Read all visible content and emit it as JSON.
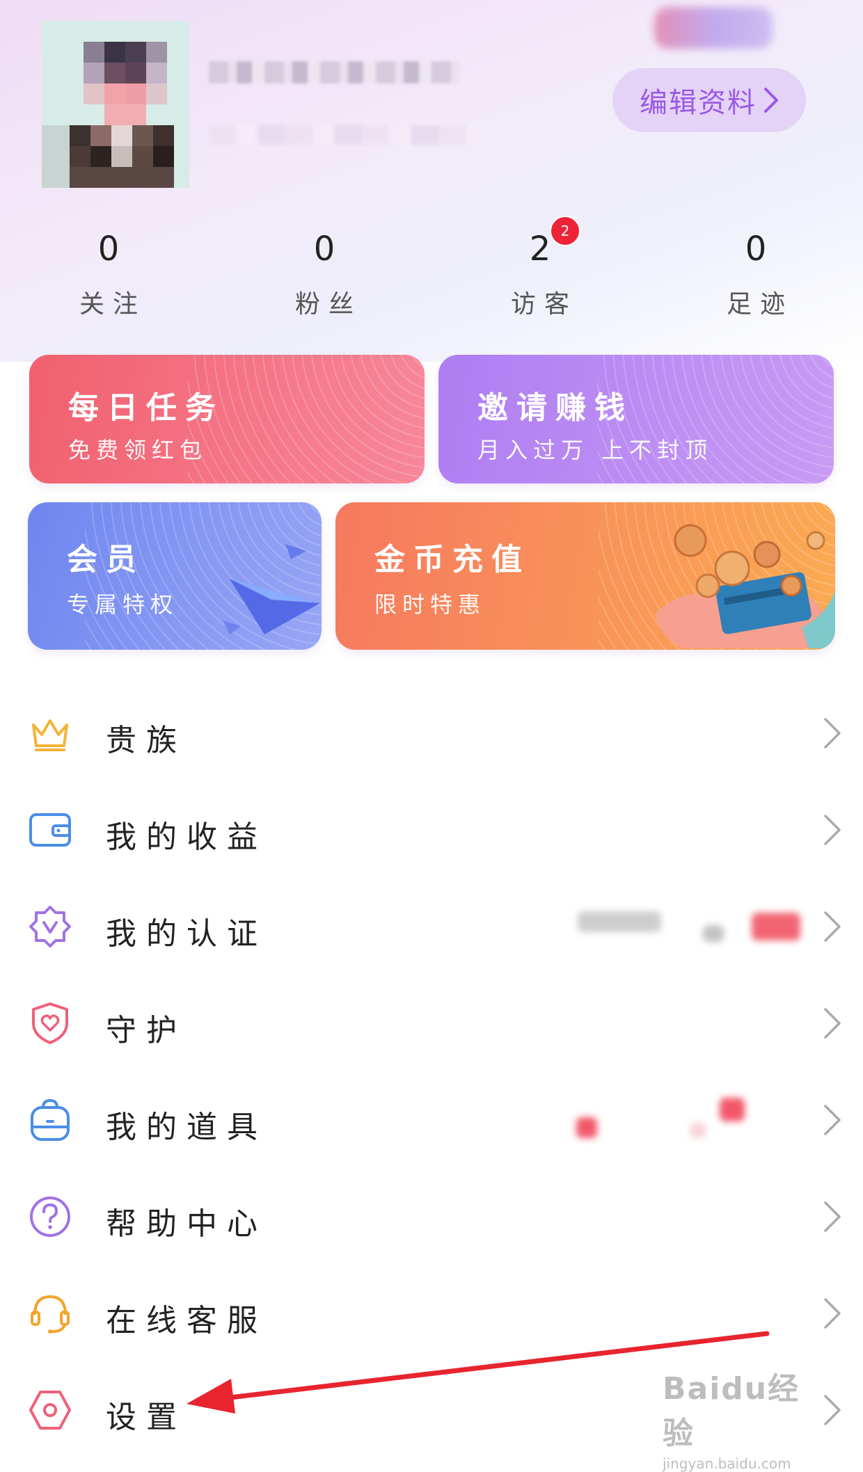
{
  "profile": {
    "edit_label": "编辑资料",
    "edit_icon": "chevron-right-icon"
  },
  "stats": [
    {
      "value": "0",
      "label": "关注"
    },
    {
      "value": "0",
      "label": "粉丝"
    },
    {
      "value": "2",
      "label": "访客",
      "badge": "2"
    },
    {
      "value": "0",
      "label": "足迹"
    }
  ],
  "cards": {
    "daily_task": {
      "title": "每日任务",
      "subtitle": "免费领红包"
    },
    "invite": {
      "title": "邀请赚钱",
      "subtitle": "月入过万 上不封顶"
    },
    "member": {
      "title": "会员",
      "subtitle": "专属特权"
    },
    "coin": {
      "title": "金币充值",
      "subtitle": "限时特惠"
    }
  },
  "menu": [
    {
      "label": "贵族",
      "icon": "crown-icon"
    },
    {
      "label": "我的收益",
      "icon": "wallet-icon"
    },
    {
      "label": "我的认证",
      "icon": "verified-badge-icon"
    },
    {
      "label": "守护",
      "icon": "shield-heart-icon"
    },
    {
      "label": "我的道具",
      "icon": "backpack-icon"
    },
    {
      "label": "帮助中心",
      "icon": "help-icon"
    },
    {
      "label": "在线客服",
      "icon": "headset-icon"
    },
    {
      "label": "设置",
      "icon": "settings-hexagon-icon"
    }
  ],
  "watermark": {
    "brand": "Baidu经验",
    "url": "jingyan.baidu.com"
  },
  "colors": {
    "accent_purple": "#9a58e5",
    "badge_red": "#ee2337",
    "arrow_red": "#e8242f"
  }
}
